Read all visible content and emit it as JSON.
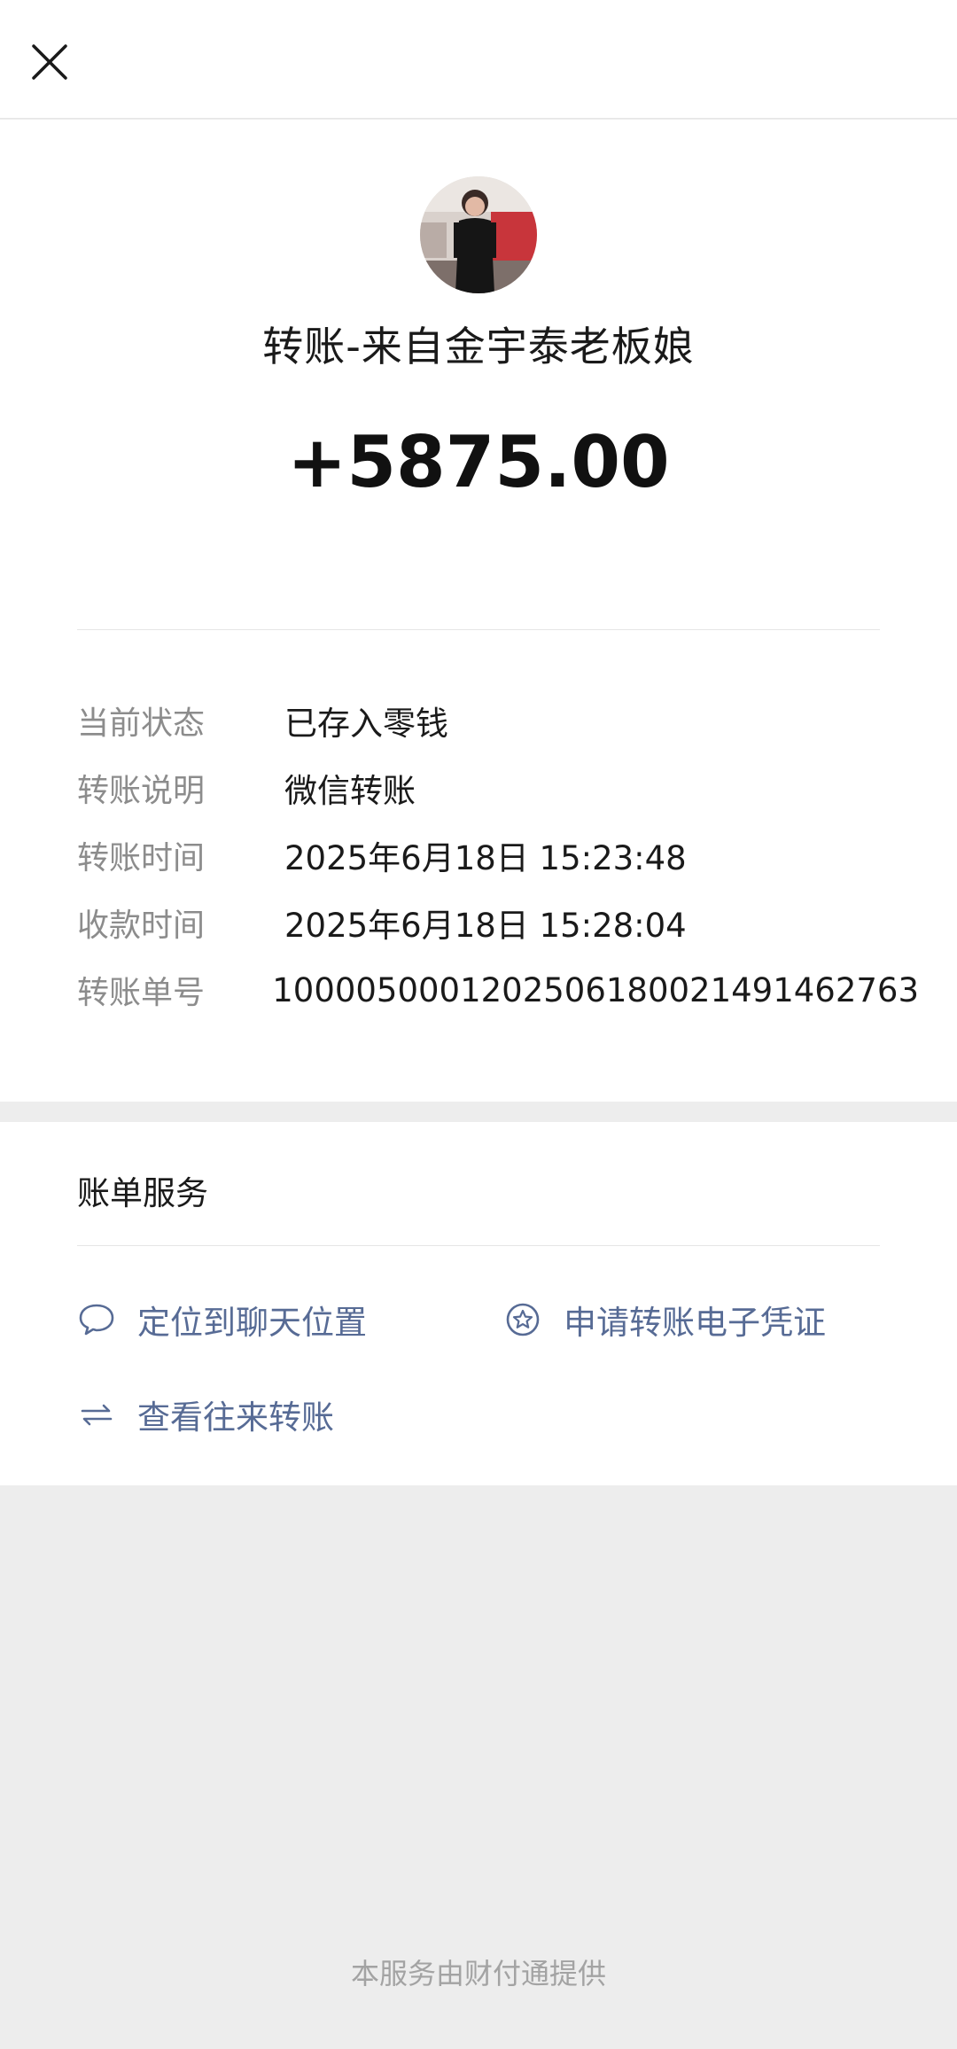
{
  "header": {
    "close_icon": "close-icon"
  },
  "transfer": {
    "avatar_icon": "user-avatar-photo",
    "title": "转账-来自金宇泰老板娘",
    "amount": "+5875.00",
    "details": [
      {
        "label": "当前状态",
        "value": "已存入零钱"
      },
      {
        "label": "转账说明",
        "value": "微信转账"
      },
      {
        "label": "转账时间",
        "value": "2025年6月18日 15:23:48"
      },
      {
        "label": "收款时间",
        "value": "2025年6月18日 15:28:04"
      },
      {
        "label": "转账单号",
        "value": "1000050001202506180021491462763"
      }
    ]
  },
  "services": {
    "title": "账单服务",
    "locate_chat": {
      "label": "定位到聊天位置",
      "icon": "chat-bubble-icon"
    },
    "apply_voucher": {
      "label": "申请转账电子凭证",
      "icon": "star-badge-icon"
    },
    "view_history": {
      "label": "查看往来转账",
      "icon": "swap-arrows-icon"
    }
  },
  "footer": {
    "text": "本服务由财付通提供"
  },
  "colors": {
    "link": "#576b95",
    "label_gray": "#8c8c8c",
    "background": "#ededed"
  }
}
